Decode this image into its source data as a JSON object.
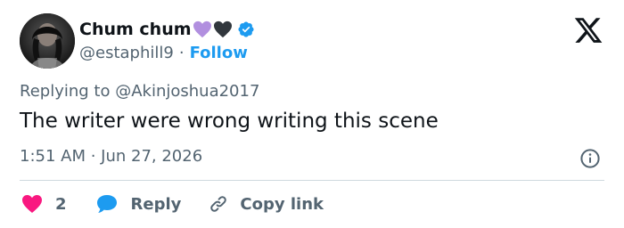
{
  "author": {
    "display_name": "Chum chum",
    "handle": "@estaphill9",
    "separator": "·",
    "follow_label": "Follow",
    "verified": true,
    "name_emojis": [
      "purple-heart",
      "black-heart"
    ]
  },
  "reply_context": {
    "prefix": "Replying to",
    "mention": "@Akinjoshua2017"
  },
  "tweet": {
    "text": "The writer were wrong writing this scene",
    "timestamp": "1:51 AM · Jun 27, 2026"
  },
  "actions": {
    "like_count": "2",
    "reply_label": "Reply",
    "copy_link_label": "Copy link"
  },
  "colors": {
    "accent": "#1d9bf0",
    "like": "#f91880",
    "text_primary": "#0f1419",
    "text_secondary": "#536471",
    "divider": "#cfd9de",
    "purple_heart": "#b18fdf",
    "black_heart": "#31373d"
  },
  "icons": {
    "logo": "x-logo-icon",
    "verified": "verified-badge-icon",
    "info": "info-icon",
    "like": "heart-icon",
    "reply": "speech-bubble-icon",
    "copy_link": "link-icon"
  }
}
